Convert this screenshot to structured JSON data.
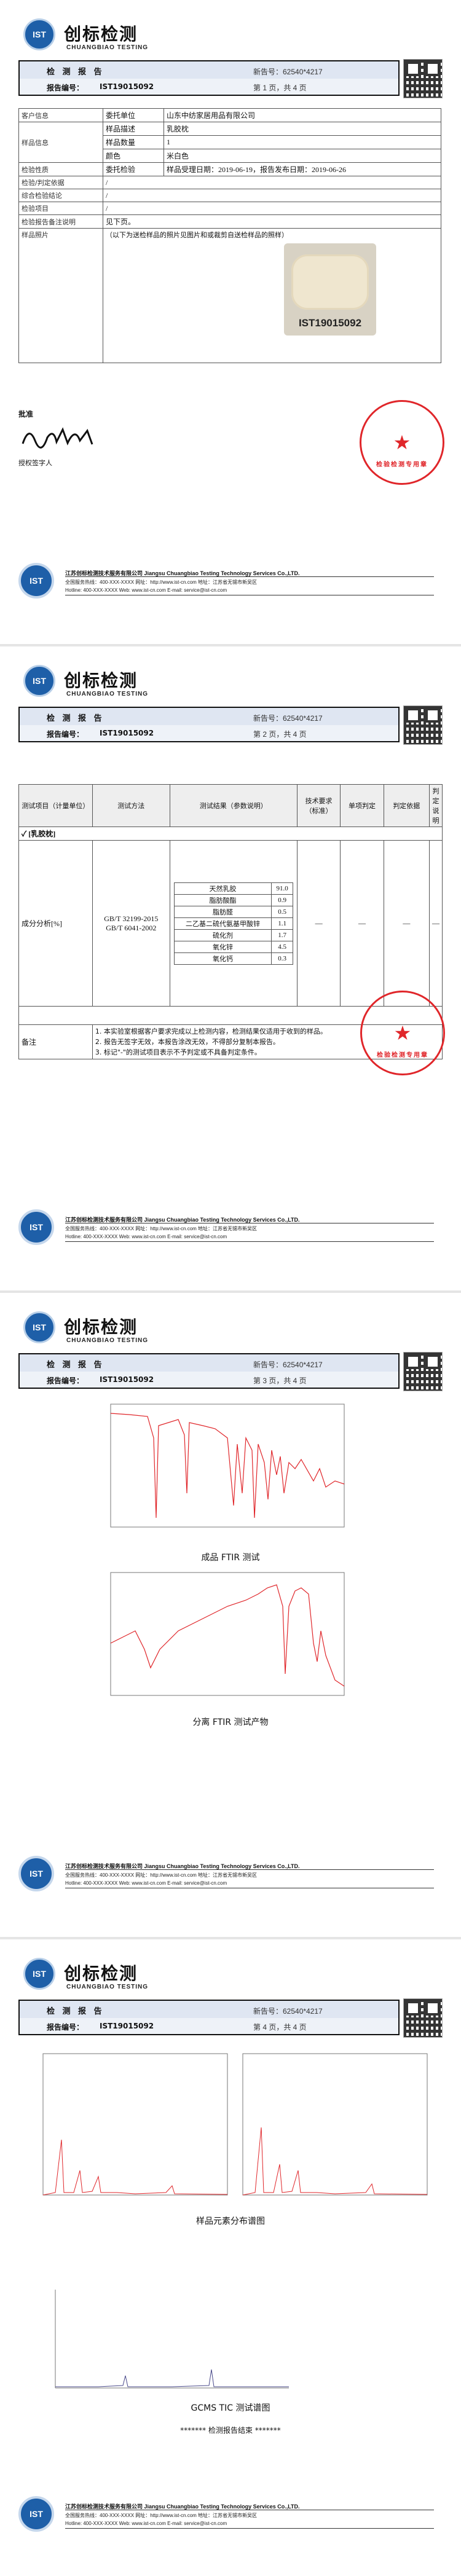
{
  "brand": {
    "cn": "创标检测",
    "en": "CHUANGBIAO TESTING",
    "logo": "IST"
  },
  "report": {
    "title_label": "检 测 报 告",
    "no_label": "报告编号：",
    "no_value": "IST19015092",
    "phone": "新告号：62540*4217",
    "pages": [
      "第 1 页，共 4 页",
      "第 2 页，共 4 页",
      "第 3 页，共 4 页",
      "第 4 页，共 4 页"
    ]
  },
  "page1": {
    "rows": [
      {
        "k": "客户信息",
        "sub": [
          {
            "k": "委托单位",
            "v": "山东中纺家居用品有限公司"
          }
        ]
      },
      {
        "k": "样品信息",
        "sub": [
          {
            "k": "样品描述",
            "v": "乳胶枕"
          },
          {
            "k": "样品数量",
            "v": "1"
          },
          {
            "k": "颜色",
            "v": "米白色"
          }
        ]
      },
      {
        "k": "检验性质",
        "sub": [
          {
            "k": "委托检验",
            "v": "样品受理日期：2019-06-19，报告发布日期：2019-06-26"
          }
        ]
      },
      {
        "k": "检验/判定依据",
        "v": "/"
      },
      {
        "k": "综合检验结论",
        "v": "/"
      },
      {
        "k": "检验项目",
        "v": "/"
      },
      {
        "k": "检验报告备注说明",
        "v": "见下页。"
      },
      {
        "k": "样品照片",
        "v": "（以下为送检样品的照片见图片和或裁剪自送检样品的照样）"
      }
    ],
    "sample_id": "IST19015092",
    "approver_label": "批准",
    "approver_sub": "授权签字人",
    "seal_text": "检验检测专用章"
  },
  "page2": {
    "headers": [
      "测试项目（计量单位）",
      "测试方法",
      "测试结果（参数说明）",
      "技术要求（标准）",
      "单项判定",
      "判定依据",
      "判定说明"
    ],
    "section": "✓ [乳胶枕]",
    "item": "成分分析[%]",
    "methods": [
      "GB/T 32199-2015",
      "GB/T 6041-2002"
    ],
    "components": [
      {
        "name": "天然乳胶",
        "value": "91.0"
      },
      {
        "name": "脂肪酸酯",
        "value": "0.9"
      },
      {
        "name": "脂肪醛",
        "value": "0.5"
      },
      {
        "name": "二乙基二硫代氨基甲酸锌",
        "value": "1.1"
      },
      {
        "name": "硫化剂",
        "value": "1.7"
      },
      {
        "name": "氧化锌",
        "value": "4.5"
      },
      {
        "name": "氧化钙",
        "value": "0.3"
      }
    ],
    "dash": "—",
    "notes_label": "备注",
    "notes": [
      "1. 本实验室根据客户要求完成以上检测内容，检测结果仅适用于收到的样品。",
      "2. 报告无签字无效，本报告涂改无效，不得部分复制本报告。",
      "3. 标记\"-\"的测试项目表示不予判定或不具备判定条件。"
    ]
  },
  "page3": {
    "cap1": "成品 FTIR 测试",
    "cap2": "分离 FTIR 测试产物"
  },
  "page4": {
    "cap1": "样品元素分布谱图",
    "cap2": "GCMS TIC 测试谱图",
    "end": "******* 检测报告结束 *******"
  },
  "footer": {
    "company": "江苏创标检测技术服务有限公司 Jiangsu Chuangbiao Testing Technology Services Co.,LTD.",
    "line2": "全国服务热线：400-XXX-XXXX  网址：http://www.ist-cn.com  地址：江苏省无锡市新吴区",
    "line3": "Hotline: 400-XXX-XXXX   Web: www.ist-cn.com   E-mail: service@ist-cn.com"
  }
}
